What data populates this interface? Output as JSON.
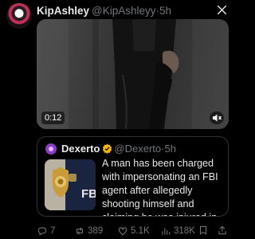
{
  "post": {
    "display_name": "KipAshley",
    "handle_time": "@KipAshleyy·5h",
    "avatar_icon": "profile-avatar",
    "video": {
      "duration": "0:12",
      "mute_icon": "speaker-mute-icon"
    }
  },
  "quoted": {
    "display_name": "Dexerto",
    "verified_color": "#f4b400",
    "handle_time": "@Dexerto·5h",
    "text": "A man has been charged with impersonating an FBI agent after allegedly shooting himself and claiming he was injured in the line of duty...",
    "thumbnail_label": "FBI"
  },
  "actions": {
    "replies": "7",
    "reposts": "389",
    "likes": "5.1K",
    "views": "318K"
  },
  "colors": {
    "background": "#000000",
    "text": "#e7e9ea",
    "muted": "#71767b",
    "border": "#2f3336"
  }
}
